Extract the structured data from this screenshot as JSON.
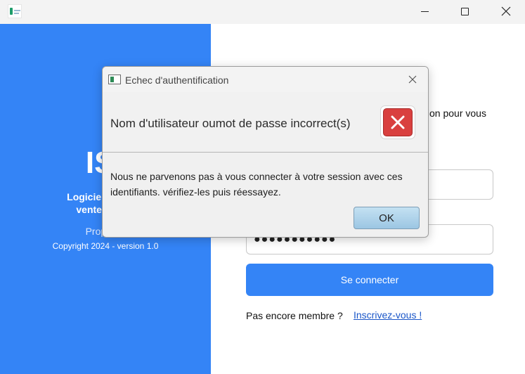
{
  "window": {
    "app_icon": "app-logo-icon",
    "controls": [
      "minimize-icon",
      "maximize-icon",
      "close-icon"
    ]
  },
  "brand": {
    "app_name": "ISt",
    "subtitle_line1": "Logiciel de gesti",
    "subtitle_line2": "vente de pro",
    "owner": "Propriéte",
    "copyright": "Copyright 2024 - version 1.0",
    "panel_color": "#3484f6"
  },
  "login": {
    "instruction_fragment": "tion pour vous",
    "username_value": "",
    "password_value": "●●●●●●●●●●●",
    "submit_label": "Se connecter",
    "signup_prompt": "Pas encore membre ?",
    "signup_link": "Inscrivez-vous !"
  },
  "dialog": {
    "title": "Echec d'authentification",
    "headline": "Nom d'utilisateur oumot de passe incorrect(s)",
    "message": "Nous ne parvenons pas à vous connecter à votre session avec ces identifiants. vérifiez-les puis réessayez.",
    "ok_label": "OK",
    "icon": "error-icon",
    "error_color": "#d9403f"
  }
}
